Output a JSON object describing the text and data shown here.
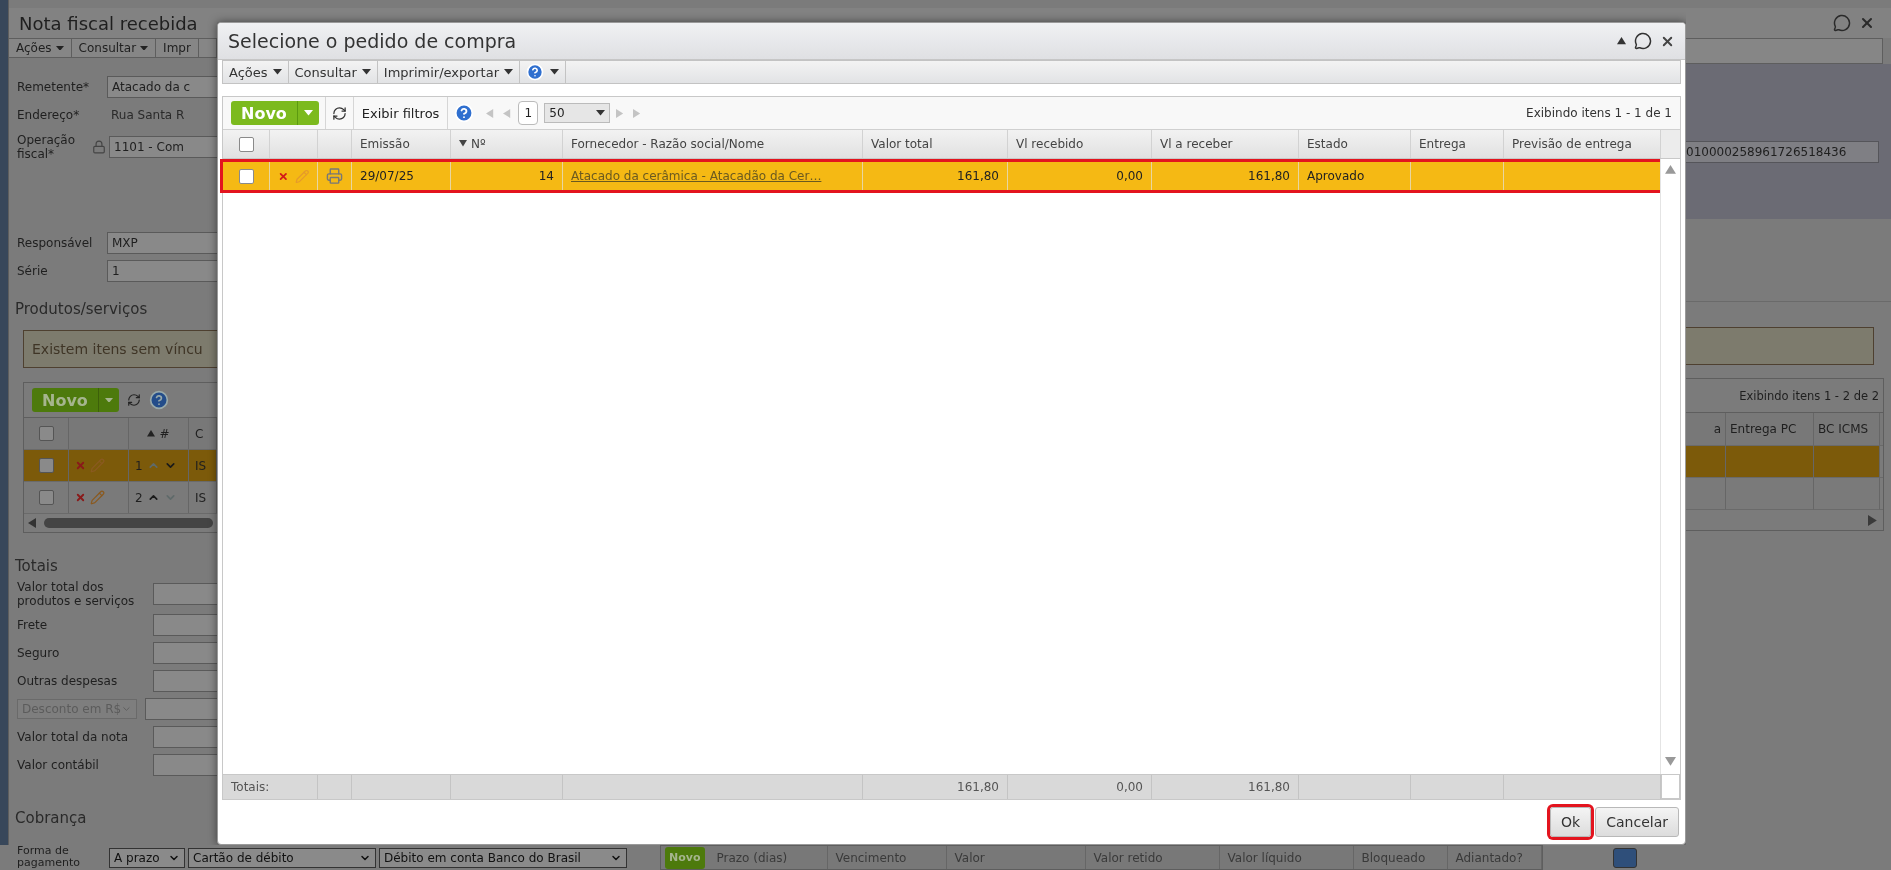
{
  "background_page": {
    "title": "Nota fiscal recebida",
    "menu": [
      {
        "label": "Ações",
        "dropdown": true
      },
      {
        "label": "Consultar",
        "dropdown": true
      },
      {
        "label": "Impr",
        "dropdown": false
      }
    ],
    "fields": [
      {
        "label": "Remetente*",
        "value": "Atacado da c",
        "kind": "input"
      },
      {
        "label": "Endereço*",
        "value": "Rua Santa R",
        "kind": "text"
      },
      {
        "label": "Operação fiscal*",
        "value": "1101 - Com",
        "kind": "locked"
      },
      {
        "label": "Responsável",
        "value": "MXP",
        "kind": "input"
      },
      {
        "label": "Série",
        "value": "1",
        "kind": "input"
      }
    ],
    "key_field": "010000258961726518436",
    "products": {
      "title": "Produtos/serviços",
      "alert": "Existem itens sem víncu",
      "new_button": "Novo",
      "showing": "Exibindo itens 1 - 2 de 2",
      "header_checked": false,
      "columns": [
        {
          "label": "#",
          "sorted": true,
          "ascending": true
        },
        {
          "label": "C",
          "sorted": false
        }
      ],
      "right_columns": [
        "a",
        "Entrega PC",
        "BC ICMS"
      ],
      "rows": [
        {
          "number": "1",
          "code": "IS",
          "selected": true,
          "checked": false,
          "move_up": false,
          "move_down": true
        },
        {
          "number": "2",
          "code": "IS",
          "selected": false,
          "checked": false,
          "move_up": true,
          "move_down": false
        }
      ]
    },
    "totals": {
      "title": "Totais",
      "fields": [
        {
          "label": "Valor total dos produtos e serviços",
          "kind": "input"
        },
        {
          "label": "Frete",
          "kind": "input"
        },
        {
          "label": "Seguro",
          "kind": "input"
        },
        {
          "label": "Outras despesas",
          "kind": "input"
        },
        {
          "label": "Desconto em R$",
          "kind": "select"
        },
        {
          "label": "Valor total da nota",
          "kind": "input"
        },
        {
          "label": "Valor contábil",
          "kind": "input"
        }
      ]
    },
    "billing": {
      "title": "Cobrança",
      "payment_label": "Forma de pagamento",
      "selects": [
        "A prazo",
        "Cartão de débito",
        "Débito em conta Banco do Brasil"
      ],
      "new_button": "Novo",
      "columns": [
        "Prazo (dias)",
        "Vencimento",
        "Valor",
        "Valor retido",
        "Valor líquido",
        "Bloqueado",
        "Adiantado?"
      ]
    }
  },
  "dialog": {
    "title": "Selecione o pedido de compra",
    "menu": [
      {
        "label": "Ações"
      },
      {
        "label": "Consultar"
      },
      {
        "label": "Imprimir/exportar"
      }
    ],
    "toolbar": {
      "new_button": "Novo",
      "filters_button": "Exibir filtros",
      "page": "1",
      "page_size": "50",
      "showing": "Exibindo itens 1 - 1 de 1"
    },
    "table": {
      "header_checked": false,
      "columns": [
        {
          "label": "Emissão",
          "sorted": false
        },
        {
          "label": "Nº",
          "sorted": true,
          "ascending": false
        },
        {
          "label": "Fornecedor - Razão social/Nome",
          "sorted": false
        },
        {
          "label": "Valor total",
          "sorted": false
        },
        {
          "label": "Vl recebido",
          "sorted": false
        },
        {
          "label": "Vl a receber",
          "sorted": false
        },
        {
          "label": "Estado",
          "sorted": false
        },
        {
          "label": "Entrega",
          "sorted": false
        },
        {
          "label": "Previsão de entrega",
          "sorted": false
        }
      ],
      "rows": [
        {
          "selected": true,
          "annotated": true,
          "checked": false,
          "date": "29/07/25",
          "number": "14",
          "supplier": "Atacado da cerâmica - Atacadão da Cer…",
          "total": "161,80",
          "received": "0,00",
          "receivable": "161,80",
          "status": "Aprovado"
        }
      ],
      "totals_label": "Totais:",
      "totals": {
        "total": "161,80",
        "received": "0,00",
        "receivable": "161,80"
      }
    },
    "buttons": [
      {
        "label": "Ok",
        "annotated": true
      },
      {
        "label": "Cancelar",
        "annotated": false
      }
    ]
  }
}
